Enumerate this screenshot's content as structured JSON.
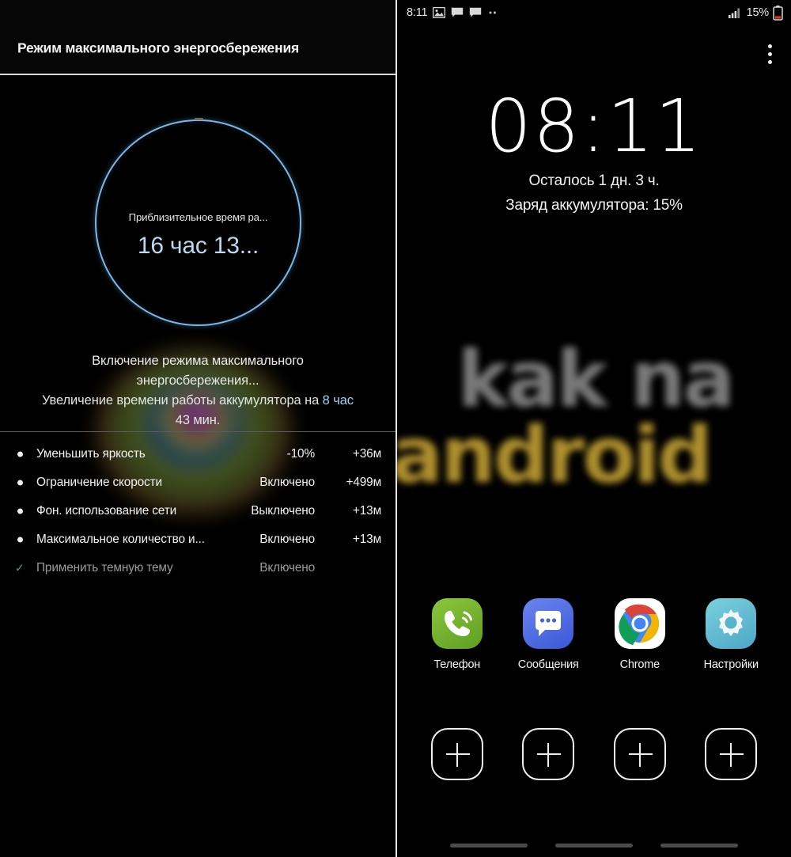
{
  "left_screen": {
    "header": {
      "title": "Режим максимального энергосбережения"
    },
    "gauge": {
      "sub_label": "Приблизительное время ра...",
      "main_value": "16 час 13...",
      "ring_color": "#79b8e8"
    },
    "description": {
      "line1": "Включение режима максимального",
      "line2": "энергосбережения...",
      "line3_prefix": "Увеличение времени работы аккумулятора на ",
      "line3_highlight": "8 час",
      "line4": "43 мин."
    },
    "savings_list": [
      {
        "marker": "bullet-icon",
        "label": "Уменьшить яркость",
        "value": "-10%",
        "delta": "+36м",
        "dim": false
      },
      {
        "marker": "bullet-icon",
        "label": "Ограничение скорости",
        "value": "Включено",
        "delta": "+499м",
        "dim": false
      },
      {
        "marker": "bullet-icon",
        "label": "Фон. использование сети",
        "value": "Выключено",
        "delta": "+13м",
        "dim": false
      },
      {
        "marker": "bullet-icon",
        "label": "Максимальное количество и...",
        "value": "Включено",
        "delta": "+13м",
        "dim": false
      },
      {
        "marker": "check-icon",
        "label": "Применить темную тему",
        "value": "Включено",
        "delta": "",
        "dim": true
      }
    ]
  },
  "right_screen": {
    "status_bar": {
      "clock": "8:11",
      "icons": [
        "image-icon",
        "message-icon",
        "message-icon",
        "more-dots-icon"
      ],
      "signal_icon": "signal-bars-icon",
      "battery_percent": "15%",
      "battery_icon": "battery-low-icon"
    },
    "overflow_menu": "overflow-menu-icon",
    "lock_clock": "08:11",
    "lock_info": {
      "remaining": "Осталось 1 дн. 3 ч.",
      "battery": "Заряд аккумулятора: 15%"
    },
    "apps": [
      {
        "label": "Телефон",
        "icon": "phone-icon"
      },
      {
        "label": "Сообщения",
        "icon": "messages-icon"
      },
      {
        "label": "Chrome",
        "icon": "chrome-icon"
      },
      {
        "label": "Настройки",
        "icon": "settings-gear-icon"
      }
    ],
    "add_slots": [
      "add-app-icon",
      "add-app-icon",
      "add-app-icon",
      "add-app-icon"
    ],
    "gesture_nav": [
      "recents-bar",
      "home-bar",
      "back-bar"
    ]
  },
  "watermark": {
    "line1": "kak na",
    "line2": "android",
    "line1_color": "#7c7c7c",
    "line2_color": "#b2922f"
  }
}
